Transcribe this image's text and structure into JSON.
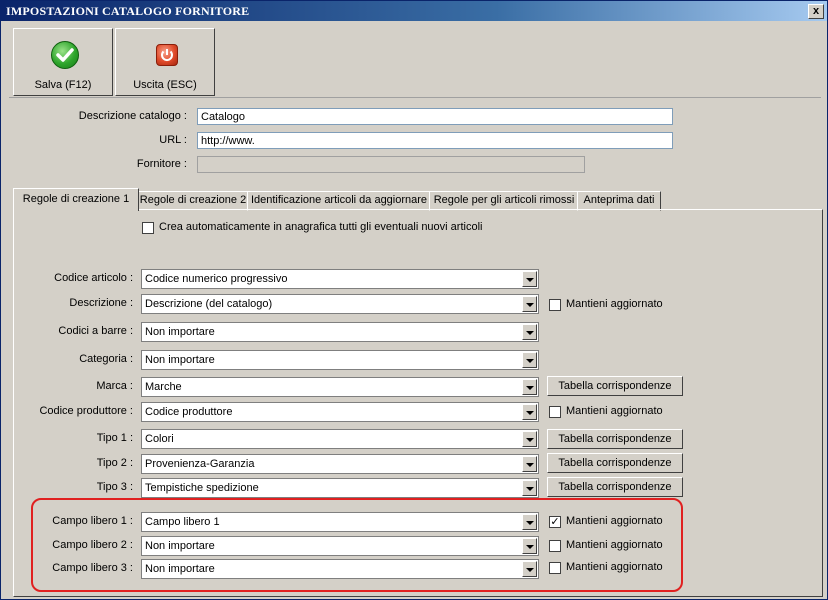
{
  "window": {
    "title": "IMPOSTAZIONI CATALOGO FORNITORE",
    "close_label": "x"
  },
  "toolbar": {
    "save": {
      "label": "Salva (F12)",
      "icon": "check-icon"
    },
    "exit": {
      "label": "Uscita (ESC)",
      "icon": "power-icon"
    }
  },
  "header_fields": {
    "descrizione": {
      "label": "Descrizione catalogo :",
      "value": "Catalogo"
    },
    "url": {
      "label": "URL :",
      "value": "http://www."
    },
    "fornitore": {
      "label": "Fornitore :",
      "value": ""
    }
  },
  "tabs": [
    {
      "label": "Regole di creazione 1",
      "active": true
    },
    {
      "label": "Regole di creazione 2",
      "active": false
    },
    {
      "label": "Identificazione articoli da aggiornare",
      "active": false
    },
    {
      "label": "Regole per gli articoli rimossi",
      "active": false
    },
    {
      "label": "Anteprima dati",
      "active": false
    }
  ],
  "auto_create": {
    "label": "Crea automaticamente in anagrafica tutti gli eventuali nuovi articoli",
    "checked": false
  },
  "rows": [
    {
      "label": "Codice articolo :",
      "value": "Codice numerico progressivo"
    },
    {
      "label": "Descrizione :",
      "value": "Descrizione (del catalogo)",
      "keep_label": "Mantieni aggiornato",
      "keep_checked": false
    },
    {
      "label": "Codici a barre :",
      "value": "Non importare"
    },
    {
      "label": "Categoria :",
      "value": "Non importare"
    },
    {
      "label": "Marca :",
      "value": "Marche",
      "button_label": "Tabella corrispondenze"
    },
    {
      "label": "Codice produttore :",
      "value": "Codice produttore",
      "keep_label": "Mantieni aggiornato",
      "keep_checked": false
    },
    {
      "label": "Tipo 1 :",
      "value": "Colori",
      "button_label": "Tabella corrispondenze"
    },
    {
      "label": "Tipo 2 :",
      "value": "Provenienza-Garanzia",
      "button_label": "Tabella corrispondenze"
    },
    {
      "label": "Tipo 3 :",
      "value": "Tempistiche spedizione",
      "button_label": "Tabella corrispondenze"
    },
    {
      "label": "Campo libero 1 :",
      "value": "Campo libero 1",
      "keep_label": "Mantieni aggiornato",
      "keep_checked": true
    },
    {
      "label": "Campo libero 2 :",
      "value": "Non importare",
      "keep_label": "Mantieni aggiornato",
      "keep_checked": false
    },
    {
      "label": "Campo libero 3 :",
      "value": "Non importare",
      "keep_label": "Mantieni aggiornato",
      "keep_checked": false
    }
  ],
  "check_mark": "✓",
  "colors": {
    "highlight": "#e02020",
    "title_bar": "#0a246a"
  }
}
